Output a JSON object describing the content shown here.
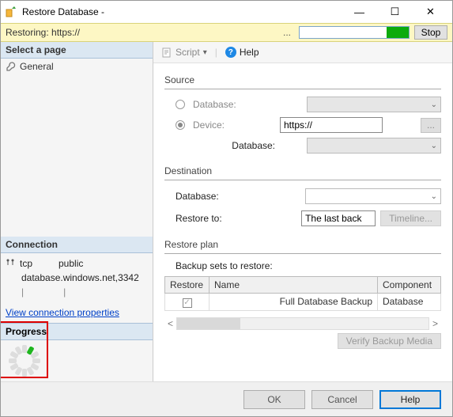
{
  "window": {
    "title": "Restore Database -"
  },
  "status": {
    "restoring": "Restoring: https://",
    "stop": "Stop"
  },
  "sidebar": {
    "select_header": "Select a page",
    "general": "General",
    "connection_header": "Connection",
    "conn_protocol": "tcp",
    "conn_schema": "public",
    "conn_db": "database.windows.net,3342",
    "view_props": "View connection properties",
    "progress_header": "Progress"
  },
  "toolbar": {
    "script": "Script",
    "help": "Help"
  },
  "source": {
    "header": "Source",
    "db_label": "Database:",
    "device_label": "Device:",
    "device_value": "https://",
    "db2_label": "Database:"
  },
  "dest": {
    "header": "Destination",
    "db_label": "Database:",
    "restore_to_label": "Restore to:",
    "restore_to_value": "The last back",
    "timeline_btn": "Timeline..."
  },
  "plan": {
    "header": "Restore plan",
    "sub": "Backup sets to restore:",
    "cols": {
      "restore": "Restore",
      "name": "Name",
      "component": "Component"
    },
    "row": {
      "name": "Full Database Backup",
      "component": "Database",
      "checked": true
    },
    "verify": "Verify Backup Media"
  },
  "footer": {
    "ok": "OK",
    "cancel": "Cancel",
    "help": "Help"
  }
}
